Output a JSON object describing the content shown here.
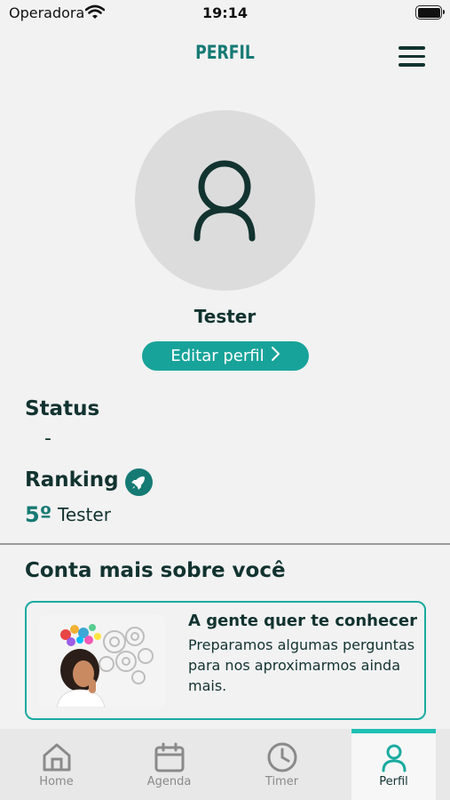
{
  "status_bar": {
    "carrier": "Operadora",
    "time": "19:14"
  },
  "header": {
    "title": "PERFIL",
    "menu_icon": "hamburger-menu-icon"
  },
  "profile": {
    "name": "Tester",
    "edit_label": "Editar perfil",
    "avatar_icon": "user-outline-icon"
  },
  "status": {
    "heading": "Status",
    "value": "-"
  },
  "ranking": {
    "heading": "Ranking",
    "icon": "rocket-icon",
    "position": "5º",
    "name": "Tester"
  },
  "more": {
    "heading": "Conta mais sobre você",
    "card_title": "A gente quer te conhecer",
    "card_desc": "Preparamos algumas perguntas para nos aproximarmos ainda mais."
  },
  "tabs": [
    {
      "label": "Home",
      "icon": "home-icon",
      "active": false
    },
    {
      "label": "Agenda",
      "icon": "calendar-icon",
      "active": false
    },
    {
      "label": "Timer",
      "icon": "clock-icon",
      "active": false
    },
    {
      "label": "Perfil",
      "icon": "user-icon",
      "active": true
    }
  ],
  "colors": {
    "accent": "#18a39a",
    "dark_teal": "#167a74",
    "text": "#123330",
    "background": "#f2f2f2"
  }
}
